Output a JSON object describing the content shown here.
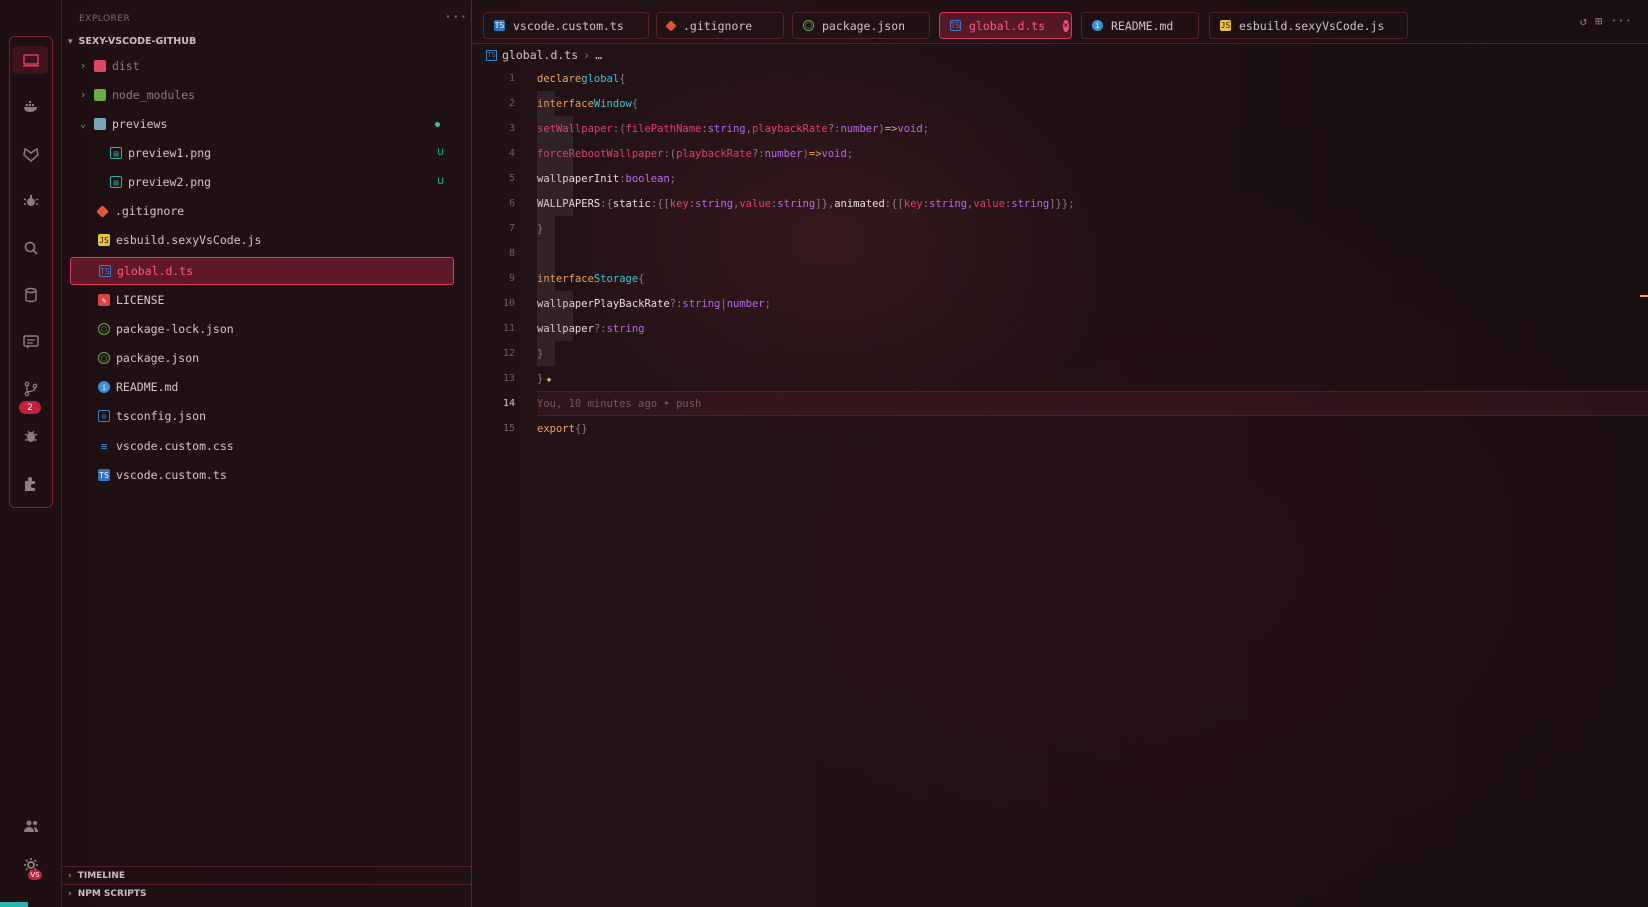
{
  "sidebar": {
    "title": "EXPLORER",
    "root": "SEXY-VSCODE-GITHUB",
    "items": [
      {
        "label": "dist",
        "type": "folder",
        "dim": true
      },
      {
        "label": "node_modules",
        "type": "folder",
        "dim": true
      },
      {
        "label": "previews",
        "type": "folder-open"
      },
      {
        "label": "preview1.png",
        "type": "image",
        "git": "U"
      },
      {
        "label": "preview2.png",
        "type": "image",
        "git": "U"
      },
      {
        "label": ".gitignore",
        "type": "git"
      },
      {
        "label": "esbuild.sexyVsCode.js",
        "type": "js"
      },
      {
        "label": "global.d.ts",
        "type": "ts",
        "selected": true
      },
      {
        "label": "LICENSE",
        "type": "license"
      },
      {
        "label": "package-lock.json",
        "type": "json"
      },
      {
        "label": "package.json",
        "type": "json"
      },
      {
        "label": "README.md",
        "type": "info"
      },
      {
        "label": "tsconfig.json",
        "type": "tsconfig"
      },
      {
        "label": "vscode.custom.css",
        "type": "css"
      },
      {
        "label": "vscode.custom.ts",
        "type": "ts"
      }
    ],
    "sections": [
      "TIMELINE",
      "NPM SCRIPTS"
    ]
  },
  "activity": {
    "source_control_badge": "2",
    "settings_badge": "VS"
  },
  "tabs": [
    {
      "label": "vscode.custom.ts",
      "icon": "ts-file-icon"
    },
    {
      "label": ".gitignore",
      "icon": "git-file-icon"
    },
    {
      "label": "package.json",
      "icon": "json-file-icon"
    },
    {
      "label": "global.d.ts",
      "icon": "ts-file-icon",
      "active": true
    },
    {
      "label": "README.md",
      "icon": "info-file-icon"
    },
    {
      "label": "esbuild.sexyVsCode.js",
      "icon": "js-file-icon"
    }
  ],
  "breadcrumb": {
    "file": "global.d.ts",
    "rest": "…"
  },
  "code": {
    "line_numbers": [
      "1",
      "2",
      "3",
      "4",
      "5",
      "6",
      "7",
      "8",
      "9",
      "10",
      "11",
      "12",
      "13",
      "14",
      "15"
    ],
    "blame": "You, 10 minutes ago • push"
  },
  "colors": {
    "accent": "#e0365e",
    "keyword": "#f0a35a",
    "type": "#3ec3d6",
    "string_type": "#b46be6"
  }
}
